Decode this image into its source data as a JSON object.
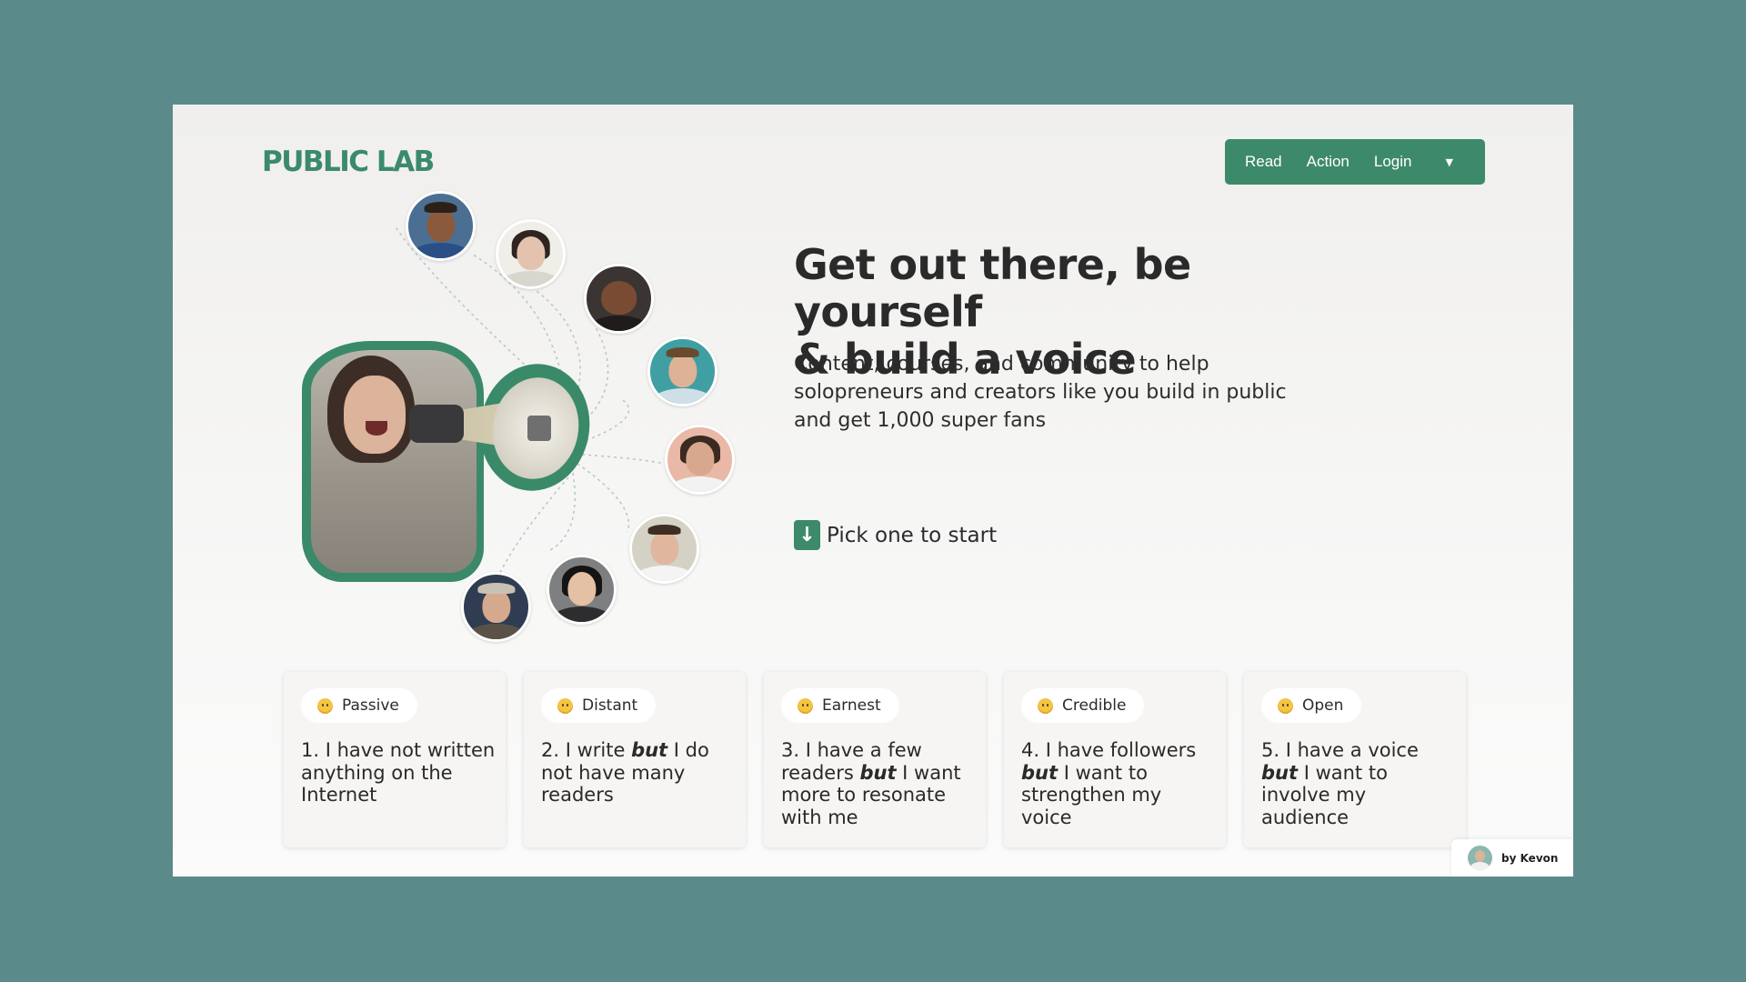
{
  "brand": {
    "logo_text": "PUBLIC LAB",
    "accent": "#3d8a6b"
  },
  "nav": {
    "items": [
      "Read",
      "Action",
      "Login"
    ],
    "dropdown_icon": "caret-down-icon"
  },
  "hero": {
    "headline": "Get out there, be yourself\n& build a voice",
    "subheadline": "Content, courses, and community to help solopreneurs and creators like you build in public and get 1,000 super fans",
    "cta_icon": "arrow-down-icon",
    "cta_label": "Pick one to start"
  },
  "illustration": {
    "megaphone_icon": "megaphone-icon",
    "avatar_count": 9
  },
  "cards": [
    {
      "tag": "Passive",
      "emoji_icon": "neutral-face-icon",
      "text_html": "1. I have not written anything on the Internet"
    },
    {
      "tag": "Distant",
      "emoji_icon": "worried-face-icon",
      "text_html": "2. I write <b>but</b> I do not have many readers"
    },
    {
      "tag": "Earnest",
      "emoji_icon": "slight-smile-icon",
      "text_html": "3. I have a few readers <b>but</b> I want more to resonate with me"
    },
    {
      "tag": "Credible",
      "emoji_icon": "smile-icon",
      "text_html": "4. I have followers <b>but</b> I want to strengthen my voice"
    },
    {
      "tag": "Open",
      "emoji_icon": "hugging-face-icon",
      "text_html": "5. I have a voice <b>but</b> I want to involve my audience"
    }
  ],
  "footer_badge": {
    "label": "by Kevon"
  }
}
